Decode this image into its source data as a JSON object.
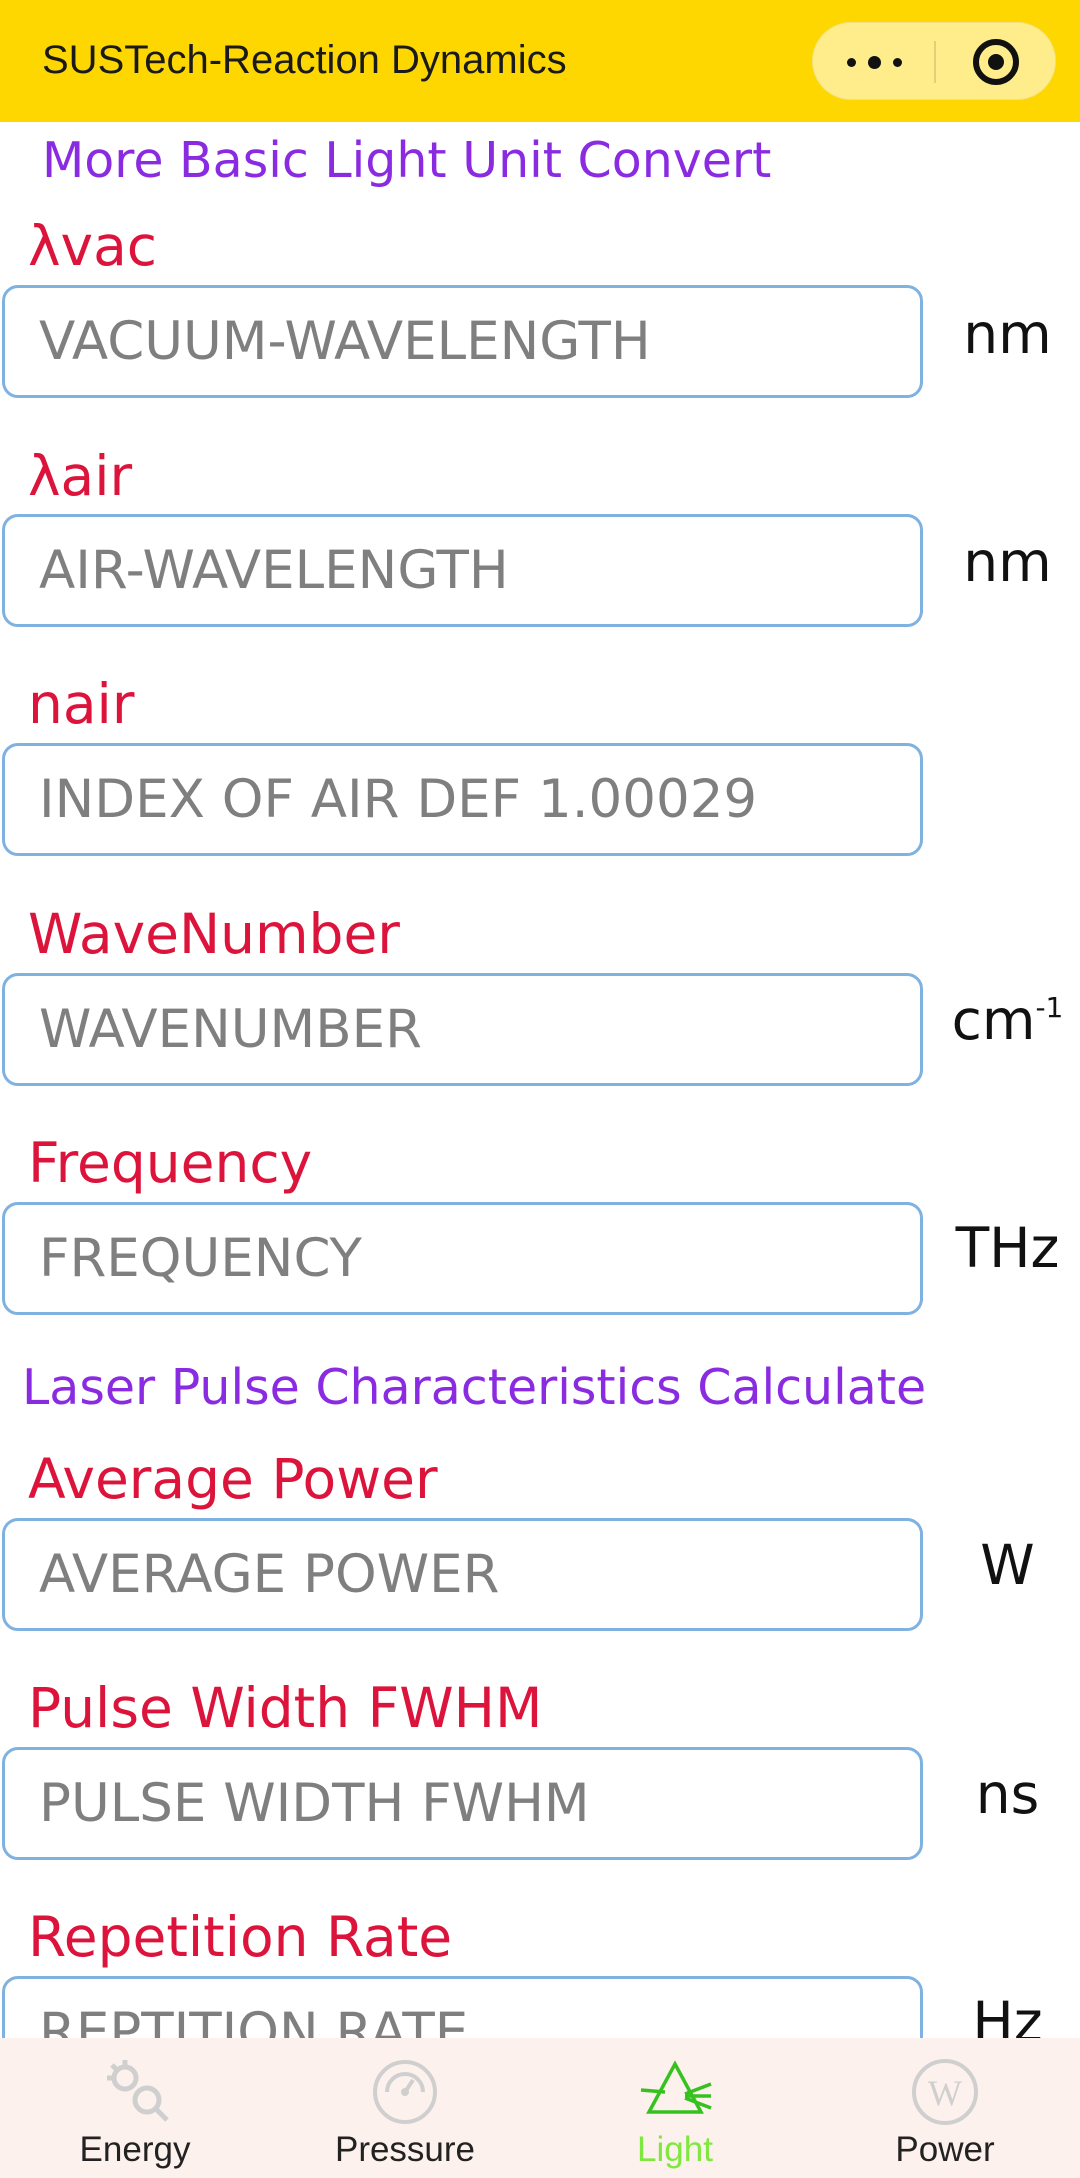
{
  "nav": {
    "title": "SUSTech-Reaction Dynamics",
    "icons": {
      "more": "more-dots-icon",
      "close": "target-circle-icon"
    }
  },
  "sections": {
    "light_unit_title": "More Basic Light Unit Convert",
    "laser_title": "Laser Pulse Characteristics Calculate"
  },
  "fields": {
    "vac": {
      "label": "λvac",
      "placeholder": "VACUUM-WAVELENGTH",
      "unit": "nm"
    },
    "air": {
      "label": "λair",
      "placeholder": "AIR-WAVELENGTH",
      "unit": "nm"
    },
    "nair": {
      "label": "nair",
      "placeholder": "INDEX OF AIR DEF 1.00029",
      "unit": ""
    },
    "wavenumber": {
      "label": "WaveNumber",
      "placeholder": "WAVENUMBER",
      "unit": "cm",
      "unit_sup": "-1"
    },
    "frequency": {
      "label": "Frequency",
      "placeholder": "FREQUENCY",
      "unit": "THz"
    },
    "avg_power": {
      "label": "Average Power",
      "placeholder": "AVERAGE POWER",
      "unit": "W"
    },
    "pulse_width": {
      "label": "Pulse Width FWHM",
      "placeholder": "PULSE WIDTH FWHM",
      "unit": "ns"
    },
    "rep_rate": {
      "label": "Repetition Rate",
      "placeholder": "REPTITION RATE",
      "unit": "Hz"
    }
  },
  "tabs": [
    {
      "label": "Energy",
      "icon": "energy-gears-icon",
      "active": false
    },
    {
      "label": "Pressure",
      "icon": "pressure-gauge-icon",
      "active": false
    },
    {
      "label": "Light",
      "icon": "prism-icon",
      "active": true
    },
    {
      "label": "Power",
      "icon": "power-w-icon",
      "active": false
    }
  ],
  "colors": {
    "nav_bg": "#FFD700",
    "section_title": "#8A2BE2",
    "field_label": "#DC143C",
    "input_border": "#7FB2E0",
    "tab_bar_bg": "#FCF1EC",
    "tab_active": "#7FE83E",
    "tab_inactive_icon": "#CCCCCC"
  }
}
